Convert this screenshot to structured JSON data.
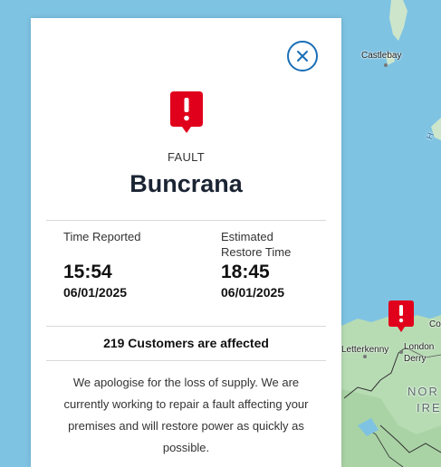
{
  "map": {
    "labels": {
      "castlebay": "Castlebay",
      "letterkenny": "Letterkenny",
      "londonderry_1": "London",
      "londonderry_2": "Derry",
      "northern_1": "NOR",
      "northern_2": "IRE",
      "co": "Co",
      "sea_letter": "H"
    },
    "pin_icon": "fault-pin-icon",
    "colors": {
      "sea": "#7fc3e3",
      "land": "#b7dcb4",
      "pin": "#e0001b"
    }
  },
  "panel": {
    "close_icon": "close-icon",
    "fault_icon": "fault-alert-icon",
    "type_label": "FAULT",
    "title": "Buncrana",
    "time_reported_label": "Time Reported",
    "time_reported": "15:54",
    "date_reported": "06/01/2025",
    "estimated_restore_label_1": "Estimated",
    "estimated_restore_label_2": "Restore Time",
    "estimated_restore_time": "18:45",
    "estimated_restore_date": "06/01/2025",
    "affected_text": "219 Customers are affected",
    "message": "We apologise for the loss of supply. We are currently working to repair a fault affecting your premises and will restore power as quickly as possible.",
    "colors": {
      "accent": "#1a6fb6",
      "alert": "#e0001b"
    }
  }
}
